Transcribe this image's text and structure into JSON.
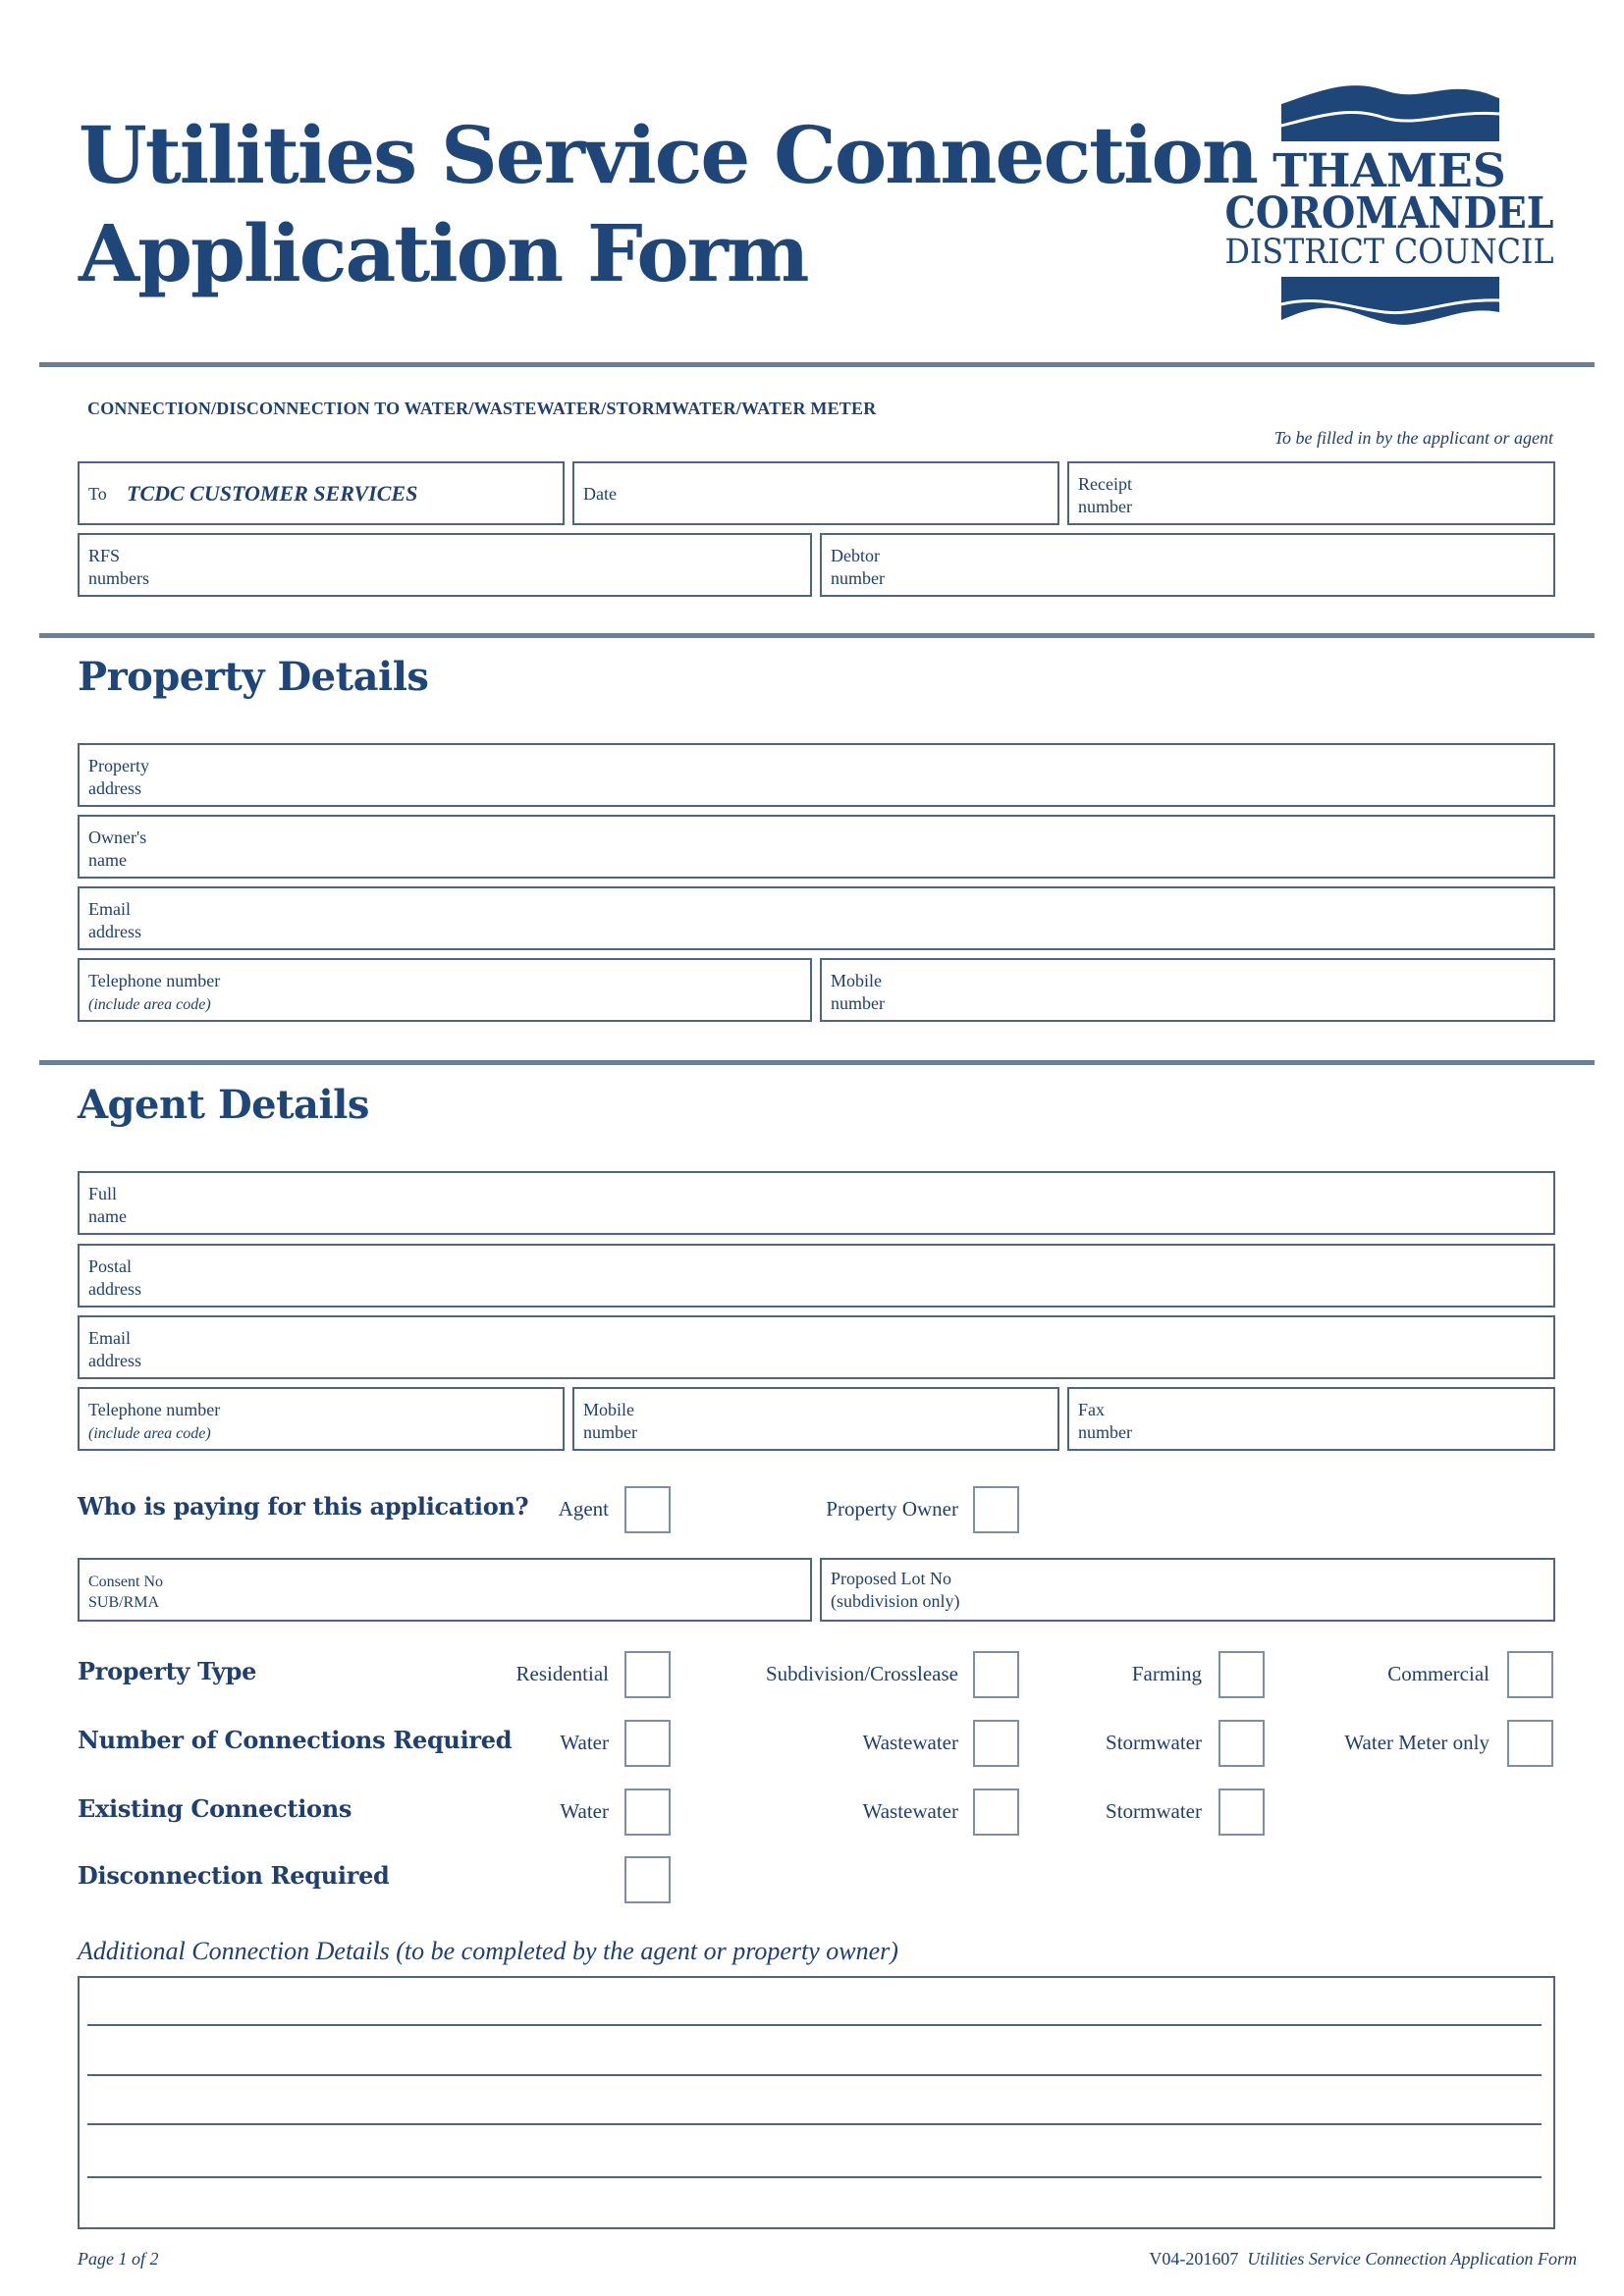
{
  "header": {
    "title_line1": "Utilities Service Connection",
    "title_line2": "Application Form",
    "logo": {
      "icon": "council-wave-logo-icon",
      "line1": "THAMES",
      "line2": "COROMANDEL",
      "line3": "DISTRICT COUNCIL",
      "color": "#1f4678"
    }
  },
  "office": {
    "subheading": "CONNECTION/DISCONNECTION TO WATER/WASTEWATER/STORMWATER/WATER METER",
    "note": "To be filled in by the applicant or agent",
    "to_label": "To",
    "to_value": "TCDC CUSTOMER SERVICES",
    "date_label": "Date",
    "receipt_label_1": "Receipt",
    "receipt_label_2": "number",
    "rfs_label_1": "RFS",
    "rfs_label_2": "numbers",
    "debtor_label_1": "Debtor",
    "debtor_label_2": "number"
  },
  "property": {
    "title": "Property Details",
    "address_1": "Property",
    "address_2": "address",
    "owner_1": "Owner's",
    "owner_2": "name",
    "email_1": "Email",
    "email_2": "address",
    "phone_1": "Telephone number",
    "phone_2": "(include area code)",
    "mobile_1": "Mobile",
    "mobile_2": "number"
  },
  "agent": {
    "title": "Agent Details",
    "name_1": "Full",
    "name_2": "name",
    "postal_1": "Postal",
    "postal_2": "address",
    "email_1": "Email",
    "email_2": "address",
    "phone_1": "Telephone number",
    "phone_2": "(include area code)",
    "mobile_1": "Mobile",
    "mobile_2": "number",
    "fax_1": "Fax",
    "fax_2": "number"
  },
  "payer": {
    "question": "Who is paying for this application?",
    "options": [
      {
        "label": "Agent",
        "checked": false
      },
      {
        "label": "Property Owner",
        "checked": false
      }
    ]
  },
  "consent": {
    "consent_1": "Consent No",
    "consent_2": "SUB/RMA",
    "lot_1": "Proposed Lot No",
    "lot_2": "(subdivision only)"
  },
  "property_type": {
    "label": "Property Type",
    "options": [
      {
        "label": "Residential",
        "checked": false
      },
      {
        "label": "Subdivision/Crosslease",
        "checked": false
      },
      {
        "label": "Farming",
        "checked": false
      },
      {
        "label": "Commercial",
        "checked": false
      }
    ]
  },
  "connections_required": {
    "label": "Number of Connections Required",
    "options": [
      {
        "label": "Water",
        "checked": false
      },
      {
        "label": "Wastewater",
        "checked": false
      },
      {
        "label": "Stormwater",
        "checked": false
      },
      {
        "label": "Water Meter only",
        "checked": false
      }
    ]
  },
  "existing_connections": {
    "label": "Existing Connections",
    "options": [
      {
        "label": "Water",
        "checked": false
      },
      {
        "label": "Wastewater",
        "checked": false
      },
      {
        "label": "Stormwater",
        "checked": false
      }
    ]
  },
  "disconnection": {
    "label": "Disconnection Required",
    "checked": false
  },
  "additional": {
    "title": "Additional Connection Details (to be completed by the agent or property owner)",
    "value": ""
  },
  "footer": {
    "page": "Page 1 of 2",
    "version": "V04-201607",
    "form_name": "Utilities Service Connection Application Form"
  }
}
